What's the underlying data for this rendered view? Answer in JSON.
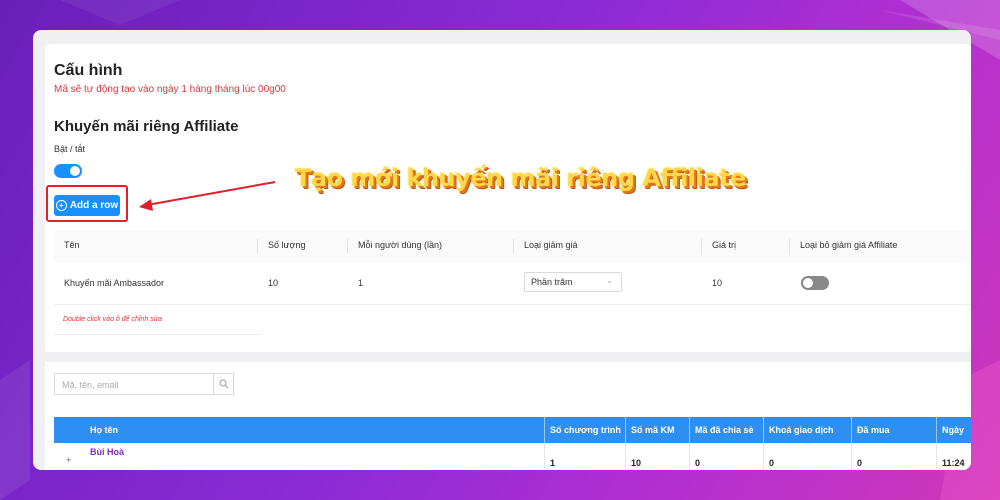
{
  "config": {
    "title": "Cấu hình",
    "subtitle": "Mã sẽ tự động tạo vào ngày 1 hàng tháng lúc 00g00"
  },
  "affiliate": {
    "title": "Khuyến mãi riêng Affiliate",
    "toggle_label": "Bật / tắt",
    "toggle_on": true,
    "add_row_label": "Add a row",
    "hint": "Double click vào ô để chỉnh sửa"
  },
  "annotation": {
    "text": "Tạo mới khuyến mãi riêng Affiliate"
  },
  "promo_table": {
    "columns": [
      "Tên",
      "Số lượng",
      "Mỗi người dùng (lần)",
      "Loại giảm giá",
      "Giá trị",
      "Loại bỏ giảm giá Affiliate"
    ],
    "rows": [
      {
        "name": "Khuyến mãi Ambassador",
        "quantity": "10",
        "per_user": "1",
        "discount_type": "Phần trăm",
        "value": "10",
        "remove_affiliate": false
      }
    ]
  },
  "search": {
    "placeholder": "Mã, tên, email"
  },
  "members_table": {
    "columns": [
      "Họ tên",
      "Số chương trình",
      "Số mã KM",
      "Mã đã chia sẻ",
      "Khoá giao dịch",
      "Đã mua",
      "Ngày"
    ],
    "rows": [
      {
        "expand": "+",
        "name": "Bùi Hoà",
        "programs": "1",
        "codes": "10",
        "shared": "0",
        "locked": "0",
        "bought": "0",
        "date": "11:24"
      }
    ]
  },
  "colors": {
    "accent": "#1890ff",
    "table_header": "#2f8ff0",
    "alert_red": "#d9363e",
    "annotation": "#ffd84a"
  }
}
